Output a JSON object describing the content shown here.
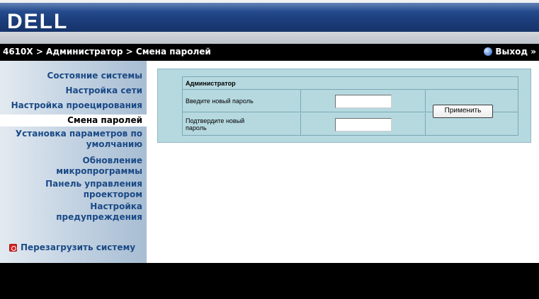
{
  "header": {
    "logo_text": "DELL"
  },
  "breadcrumb": {
    "text": "4610X > Администратор > Смена паролей",
    "logout_label": "Выход »"
  },
  "sidebar": {
    "items": [
      {
        "label": "Состояние системы"
      },
      {
        "label": "Настройка сети"
      },
      {
        "label": "Настройка проецирования"
      },
      {
        "label": "Смена паролей",
        "active": true
      },
      {
        "label_line1": "Установка параметров по",
        "label_line2": "умолчанию"
      },
      {
        "label_line1": "Обновление",
        "label_line2": "микропрограммы"
      },
      {
        "label_line1": "Панель управления",
        "label_line2": "проектором"
      },
      {
        "label_line1": "Настройка",
        "label_line2": "предупреждения"
      }
    ],
    "reboot_label": "Перезагрузить систему"
  },
  "form": {
    "title": "Администратор",
    "new_password_label": "Введите новый пароль",
    "new_password_value": "",
    "confirm_password_label_line1": "Подтвердите новый",
    "confirm_password_label_line2": "пароль",
    "confirm_password_value": "",
    "apply_label": "Применить"
  },
  "colors": {
    "logo_bar": "#1d3f7d",
    "panel_bg": "#b6d9e0",
    "nav_text": "#1b4a86",
    "breadcrumb_bg": "#000000"
  }
}
